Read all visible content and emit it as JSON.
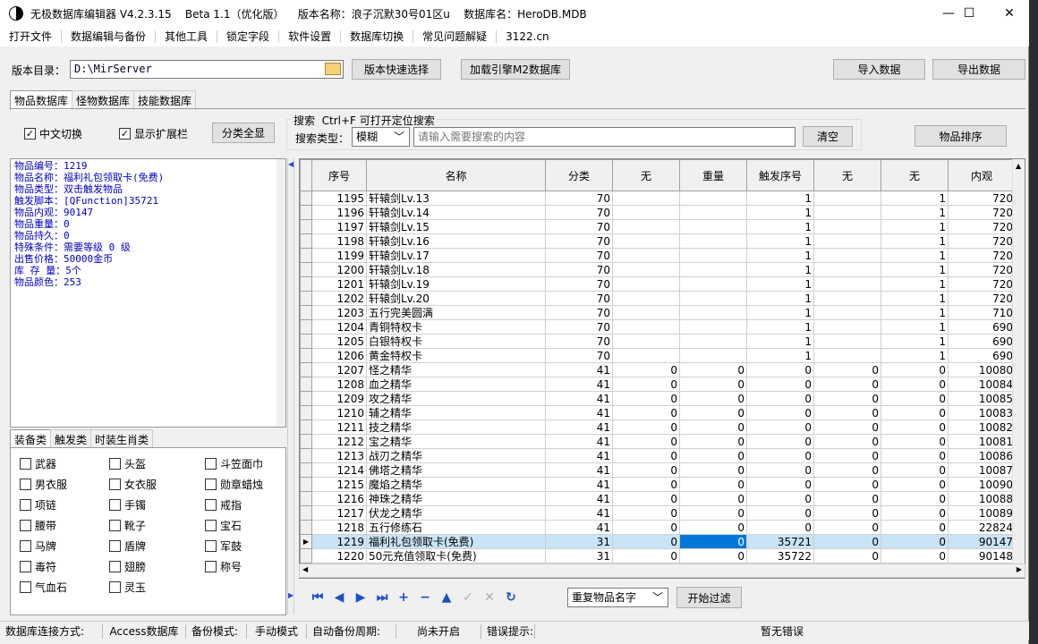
{
  "window": {
    "title": "无极数据库编辑器 V4.2.3.15    Beta 1.1（优化版）    版本名称：浪子沉默30号01区u    数据库名：HeroDB.MDB",
    "minimize": "—",
    "maximize": "☐",
    "close": "✕"
  },
  "menu": [
    "打开文件",
    "数据编辑与备份",
    "其他工具",
    "锁定字段",
    "软件设置",
    "数据库切换",
    "常见问题解疑",
    "3122.cn"
  ],
  "toolbar": {
    "dir_label": "版本目录：",
    "dir_value": "D:\\MirServer",
    "quick_select": "版本快速选择",
    "load_m2": "加载引擎M2数据库",
    "import": "导入数据",
    "export": "导出数据"
  },
  "tabs": [
    "物品数据库",
    "怪物数据库",
    "技能数据库"
  ],
  "options": {
    "chinese_switch": "中文切换",
    "show_ext": "显示扩展栏",
    "show_all_btn": "分类全显",
    "search_group_title": "搜索  Ctrl+F 可打开定位搜索",
    "search_type_label": "搜索类型：",
    "search_type_value": "模糊",
    "search_placeholder": "请输入需要搜索的内容",
    "clear_btn": "清空",
    "sort_btn": "物品排序"
  },
  "item_info": [
    "物品编号：1219",
    "物品名称：福利礼包领取卡(免费)",
    "物品类型：双击触发物品",
    "触发脚本：[QFunction]35721",
    "物品内观：90147",
    "物品重量：0",
    "物品持久：0",
    "特殊条件：需要等级 0 级",
    "出售价格：50000金币",
    "库 存 量：5个",
    "物品颜色：253"
  ],
  "cat_tabs": [
    "装备类",
    "触发类",
    "时装生肖类"
  ],
  "categories": [
    "武器",
    "头盔",
    "斗笠面巾",
    "男衣服",
    "女衣服",
    "勋章蜡烛",
    "项链",
    "手镯",
    "戒指",
    "腰带",
    "靴子",
    "宝石",
    "马牌",
    "盾牌",
    "军鼓",
    "毒符",
    "翅膀",
    "称号",
    "气血石",
    "灵玉"
  ],
  "grid": {
    "columns": [
      "序号",
      "名称",
      "分类",
      "无",
      "重量",
      "触发序号",
      "无",
      "无",
      "内观"
    ],
    "rows": [
      [
        "1195",
        "轩辕剑Lv.13",
        "70",
        "",
        "",
        "1",
        "",
        "1",
        "720"
      ],
      [
        "1196",
        "轩辕剑Lv.14",
        "70",
        "",
        "",
        "1",
        "",
        "1",
        "720"
      ],
      [
        "1197",
        "轩辕剑Lv.15",
        "70",
        "",
        "",
        "1",
        "",
        "1",
        "720"
      ],
      [
        "1198",
        "轩辕剑Lv.16",
        "70",
        "",
        "",
        "1",
        "",
        "1",
        "720"
      ],
      [
        "1199",
        "轩辕剑Lv.17",
        "70",
        "",
        "",
        "1",
        "",
        "1",
        "720"
      ],
      [
        "1200",
        "轩辕剑Lv.18",
        "70",
        "",
        "",
        "1",
        "",
        "1",
        "720"
      ],
      [
        "1201",
        "轩辕剑Lv.19",
        "70",
        "",
        "",
        "1",
        "",
        "1",
        "720"
      ],
      [
        "1202",
        "轩辕剑Lv.20",
        "70",
        "",
        "",
        "1",
        "",
        "1",
        "720"
      ],
      [
        "1203",
        "五行完美圆满",
        "70",
        "",
        "",
        "1",
        "",
        "1",
        "710"
      ],
      [
        "1204",
        "青铜特权卡",
        "70",
        "",
        "",
        "1",
        "",
        "1",
        "690"
      ],
      [
        "1205",
        "白银特权卡",
        "70",
        "",
        "",
        "1",
        "",
        "1",
        "690"
      ],
      [
        "1206",
        "黄金特权卡",
        "70",
        "",
        "",
        "1",
        "",
        "1",
        "690"
      ],
      [
        "1207",
        "怪之精华",
        "41",
        "0",
        "0",
        "0",
        "0",
        "0",
        "10080"
      ],
      [
        "1208",
        "血之精华",
        "41",
        "0",
        "0",
        "0",
        "0",
        "0",
        "10084"
      ],
      [
        "1209",
        "攻之精华",
        "41",
        "0",
        "0",
        "0",
        "0",
        "0",
        "10085"
      ],
      [
        "1210",
        "辅之精华",
        "41",
        "0",
        "0",
        "0",
        "0",
        "0",
        "10083"
      ],
      [
        "1211",
        "技之精华",
        "41",
        "0",
        "0",
        "0",
        "0",
        "0",
        "10082"
      ],
      [
        "1212",
        "宝之精华",
        "41",
        "0",
        "0",
        "0",
        "0",
        "0",
        "10081"
      ],
      [
        "1213",
        "战刃之精华",
        "41",
        "0",
        "0",
        "0",
        "0",
        "0",
        "10086"
      ],
      [
        "1214",
        "佛塔之精华",
        "41",
        "0",
        "0",
        "0",
        "0",
        "0",
        "10087"
      ],
      [
        "1215",
        "魔焰之精华",
        "41",
        "0",
        "0",
        "0",
        "0",
        "0",
        "10090"
      ],
      [
        "1216",
        "神珠之精华",
        "41",
        "0",
        "0",
        "0",
        "0",
        "0",
        "10088"
      ],
      [
        "1217",
        "伏龙之精华",
        "41",
        "0",
        "0",
        "0",
        "0",
        "0",
        "10089"
      ],
      [
        "1218",
        "五行修练石",
        "41",
        "0",
        "0",
        "0",
        "0",
        "0",
        "22824"
      ],
      [
        "1219",
        "福利礼包领取卡(免费)",
        "31",
        "0",
        "0",
        "35721",
        "0",
        "0",
        "90147"
      ],
      [
        "1220",
        "50元充值领取卡(免费)",
        "31",
        "0",
        "0",
        "35722",
        "0",
        "0",
        "90148"
      ]
    ],
    "selected_row": 24
  },
  "filter": {
    "dropdown": "重复物品名字",
    "start_btn": "开始过滤"
  },
  "statusbar": {
    "conn_label": "数据库连接方式:",
    "conn_value": "Access数据库",
    "backup_label": "备份模式:",
    "backup_value": "手动模式",
    "auto_label": "自动备份周期:",
    "auto_value": "尚未开启",
    "err_label": "错误提示:",
    "err_value": "暂无错误"
  }
}
